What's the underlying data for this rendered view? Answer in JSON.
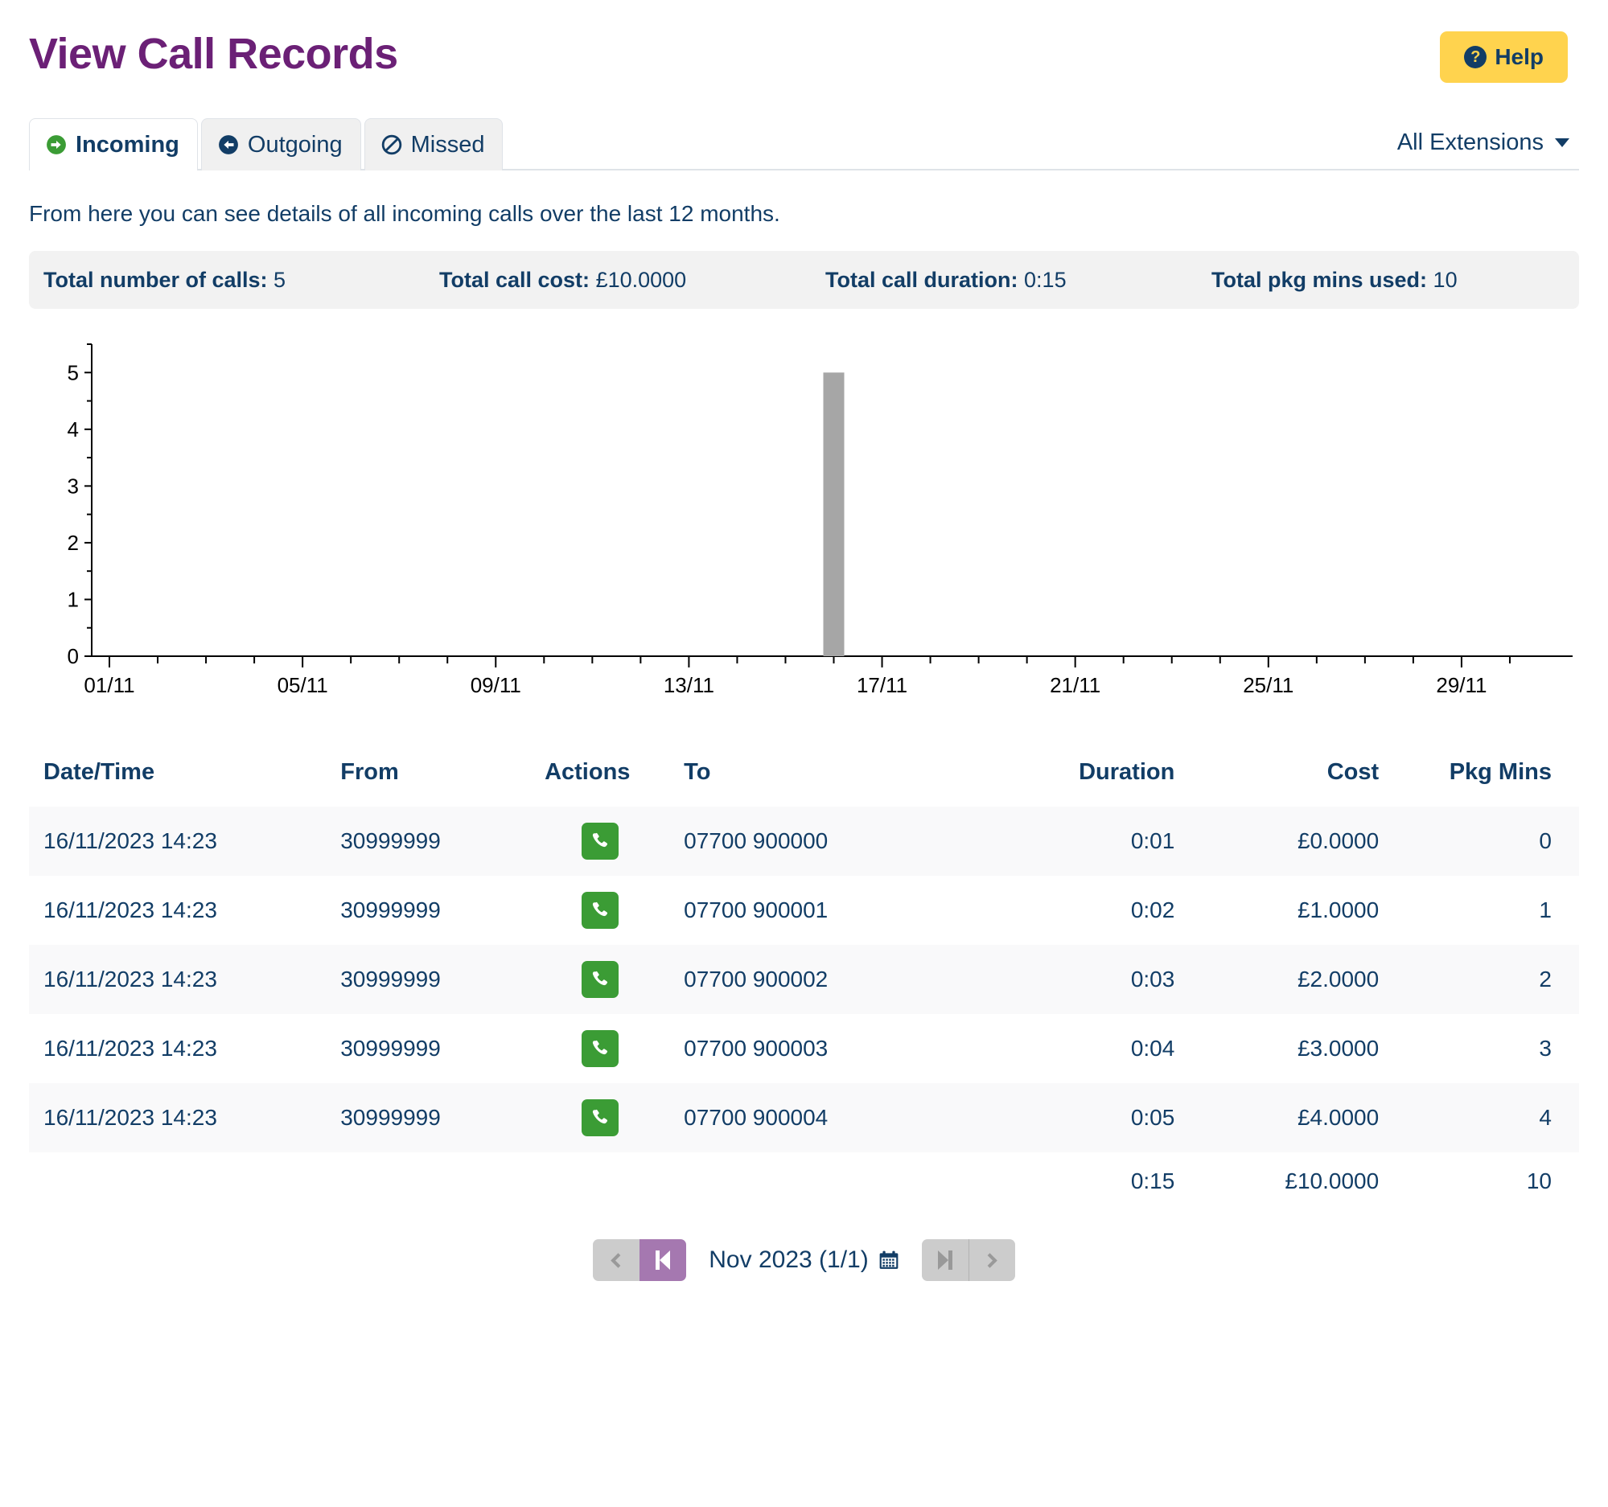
{
  "header": {
    "title": "View Call Records",
    "help_label": "Help",
    "help_icon": "question-circle-icon",
    "help_bg": "#ffd34e",
    "help_fg": "#123d66"
  },
  "tabs": [
    {
      "label": "Incoming",
      "icon": "arrow-circle-right-icon",
      "icon_color": "#3b9c35",
      "active": true
    },
    {
      "label": "Outgoing",
      "icon": "arrow-circle-left-icon",
      "icon_color": "#123d66",
      "active": false
    },
    {
      "label": "Missed",
      "icon": "ban-circle-icon",
      "icon_color": "#123d66",
      "active": false
    }
  ],
  "extensions_filter": {
    "label": "All Extensions",
    "icon": "chevron-down-icon"
  },
  "intro": "From here you can see details of all incoming calls over the last 12 months.",
  "summary": [
    {
      "label": "Total number of calls:",
      "value": "5"
    },
    {
      "label": "Total call cost:",
      "value": "£10.0000"
    },
    {
      "label": "Total call duration:",
      "value": "0:15"
    },
    {
      "label": "Total pkg mins used:",
      "value": "10"
    }
  ],
  "chart_data": {
    "type": "bar",
    "title": "",
    "xlabel": "",
    "ylabel": "",
    "ylim": [
      0,
      5.5
    ],
    "yticks": [
      0,
      1,
      2,
      3,
      4,
      5
    ],
    "ytick_labels": [
      "0",
      "1",
      "2",
      "3",
      "4",
      "5"
    ],
    "y_minor_ticks": [
      0.5,
      1.5,
      2.5,
      3.5,
      4.5,
      5.5
    ],
    "grid": false,
    "legend": "none",
    "bar_color": "#a6a6a6",
    "axis_color": "#000000",
    "x_range": [
      "01/11",
      "30/11"
    ],
    "xtick_labels": [
      "01/11",
      "05/11",
      "09/11",
      "13/11",
      "17/11",
      "21/11",
      "25/11",
      "29/11"
    ],
    "xtick_label_days": [
      1,
      5,
      9,
      13,
      17,
      21,
      25,
      29
    ],
    "x_all_tick_days": [
      1,
      2,
      3,
      4,
      5,
      6,
      7,
      8,
      9,
      10,
      11,
      12,
      13,
      14,
      15,
      16,
      17,
      18,
      19,
      20,
      21,
      22,
      23,
      24,
      25,
      26,
      27,
      28,
      29,
      30
    ],
    "categories": [
      "01/11",
      "02/11",
      "03/11",
      "04/11",
      "05/11",
      "06/11",
      "07/11",
      "08/11",
      "09/11",
      "10/11",
      "11/11",
      "12/11",
      "13/11",
      "14/11",
      "15/11",
      "16/11",
      "17/11",
      "18/11",
      "19/11",
      "20/11",
      "21/11",
      "22/11",
      "23/11",
      "24/11",
      "25/11",
      "26/11",
      "27/11",
      "28/11",
      "29/11",
      "30/11"
    ],
    "values": [
      0,
      0,
      0,
      0,
      0,
      0,
      0,
      0,
      0,
      0,
      0,
      0,
      0,
      0,
      0,
      5,
      0,
      0,
      0,
      0,
      0,
      0,
      0,
      0,
      0,
      0,
      0,
      0,
      0,
      0
    ]
  },
  "table": {
    "columns": [
      "Date/Time",
      "From",
      "Actions",
      "To",
      "Duration",
      "Cost",
      "Pkg Mins"
    ],
    "rows": [
      {
        "datetime": "16/11/2023 14:23",
        "from": "30999999",
        "action_icon": "phone-icon",
        "to": "07700 900000",
        "duration": "0:01",
        "cost": "£0.0000",
        "pkg": "0"
      },
      {
        "datetime": "16/11/2023 14:23",
        "from": "30999999",
        "action_icon": "phone-icon",
        "to": "07700 900001",
        "duration": "0:02",
        "cost": "£1.0000",
        "pkg": "1"
      },
      {
        "datetime": "16/11/2023 14:23",
        "from": "30999999",
        "action_icon": "phone-icon",
        "to": "07700 900002",
        "duration": "0:03",
        "cost": "£2.0000",
        "pkg": "2"
      },
      {
        "datetime": "16/11/2023 14:23",
        "from": "30999999",
        "action_icon": "phone-icon",
        "to": "07700 900003",
        "duration": "0:04",
        "cost": "£3.0000",
        "pkg": "3"
      },
      {
        "datetime": "16/11/2023 14:23",
        "from": "30999999",
        "action_icon": "phone-icon",
        "to": "07700 900004",
        "duration": "0:05",
        "cost": "£4.0000",
        "pkg": "4"
      }
    ],
    "totals": {
      "duration": "0:15",
      "cost": "£10.0000",
      "pkg": "10"
    }
  },
  "pagination": {
    "prev_icon": "chevron-left-icon",
    "first_icon": "step-backward-icon",
    "label": "Nov 2023 (1/1)",
    "calendar_icon": "calendar-icon",
    "last_icon": "step-forward-icon",
    "next_icon": "chevron-right-icon",
    "active_color": "#a578b0",
    "inactive_color": "#cccccc"
  }
}
